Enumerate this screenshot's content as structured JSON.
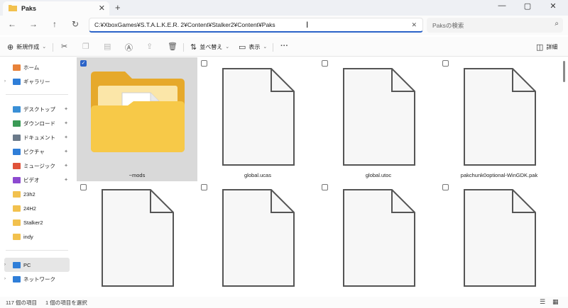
{
  "window": {
    "tab_title": "Paks",
    "tab_close": "✕",
    "new_tab": "+",
    "minimize": "—",
    "maximize": "▢",
    "close": "✕"
  },
  "address": {
    "path": "C:¥XboxGames¥S.T.A.L.K.E.R. 2¥Content¥Stalker2¥Content¥Paks",
    "search_placeholder": "Paksの検索"
  },
  "toolbar": {
    "new_label": "新規作成",
    "sort_label": "並べ替え",
    "view_label": "表示",
    "details_label": "詳細",
    "more_label": "···"
  },
  "sidebar": {
    "items": [
      {
        "label": "ホーム",
        "pinned": false,
        "color": "#e8823a"
      },
      {
        "label": "ギャラリー",
        "pinned": false,
        "color": "#2f7ed8"
      },
      {
        "label": "デスクトップ",
        "pinned": true,
        "color": "#3a8fd6"
      },
      {
        "label": "ダウンロード",
        "pinned": true,
        "color": "#3a9a56"
      },
      {
        "label": "ドキュメント",
        "pinned": true,
        "color": "#6b7a8a"
      },
      {
        "label": "ピクチャ",
        "pinned": true,
        "color": "#2f7ed8"
      },
      {
        "label": "ミュージック",
        "pinned": true,
        "color": "#e0533a"
      },
      {
        "label": "ビデオ",
        "pinned": true,
        "color": "#8d4ad0"
      },
      {
        "label": "23h2",
        "pinned": false,
        "color": "#f2c14e"
      },
      {
        "label": "24H2",
        "pinned": false,
        "color": "#f2c14e"
      },
      {
        "label": "Stalker2",
        "pinned": false,
        "color": "#f2c14e"
      },
      {
        "label": "indy",
        "pinned": false,
        "color": "#f2c14e"
      },
      {
        "label": "PC",
        "pinned": false,
        "color": "#2f7ed8"
      },
      {
        "label": "ネットワーク",
        "pinned": false,
        "color": "#2f7ed8"
      }
    ]
  },
  "files": [
    {
      "name": "~mods",
      "type": "folder",
      "selected": true
    },
    {
      "name": "global.ucas",
      "type": "file",
      "selected": false
    },
    {
      "name": "global.utoc",
      "type": "file",
      "selected": false
    },
    {
      "name": "pakchunk0optional-WinGDK.pak",
      "type": "file",
      "selected": false
    },
    {
      "name": "",
      "type": "file",
      "selected": false
    },
    {
      "name": "",
      "type": "file",
      "selected": false
    },
    {
      "name": "",
      "type": "file",
      "selected": false
    },
    {
      "name": "",
      "type": "file",
      "selected": false
    }
  ],
  "status": {
    "item_count": "117 個の項目",
    "selected_count": "1 個の項目を選択"
  }
}
